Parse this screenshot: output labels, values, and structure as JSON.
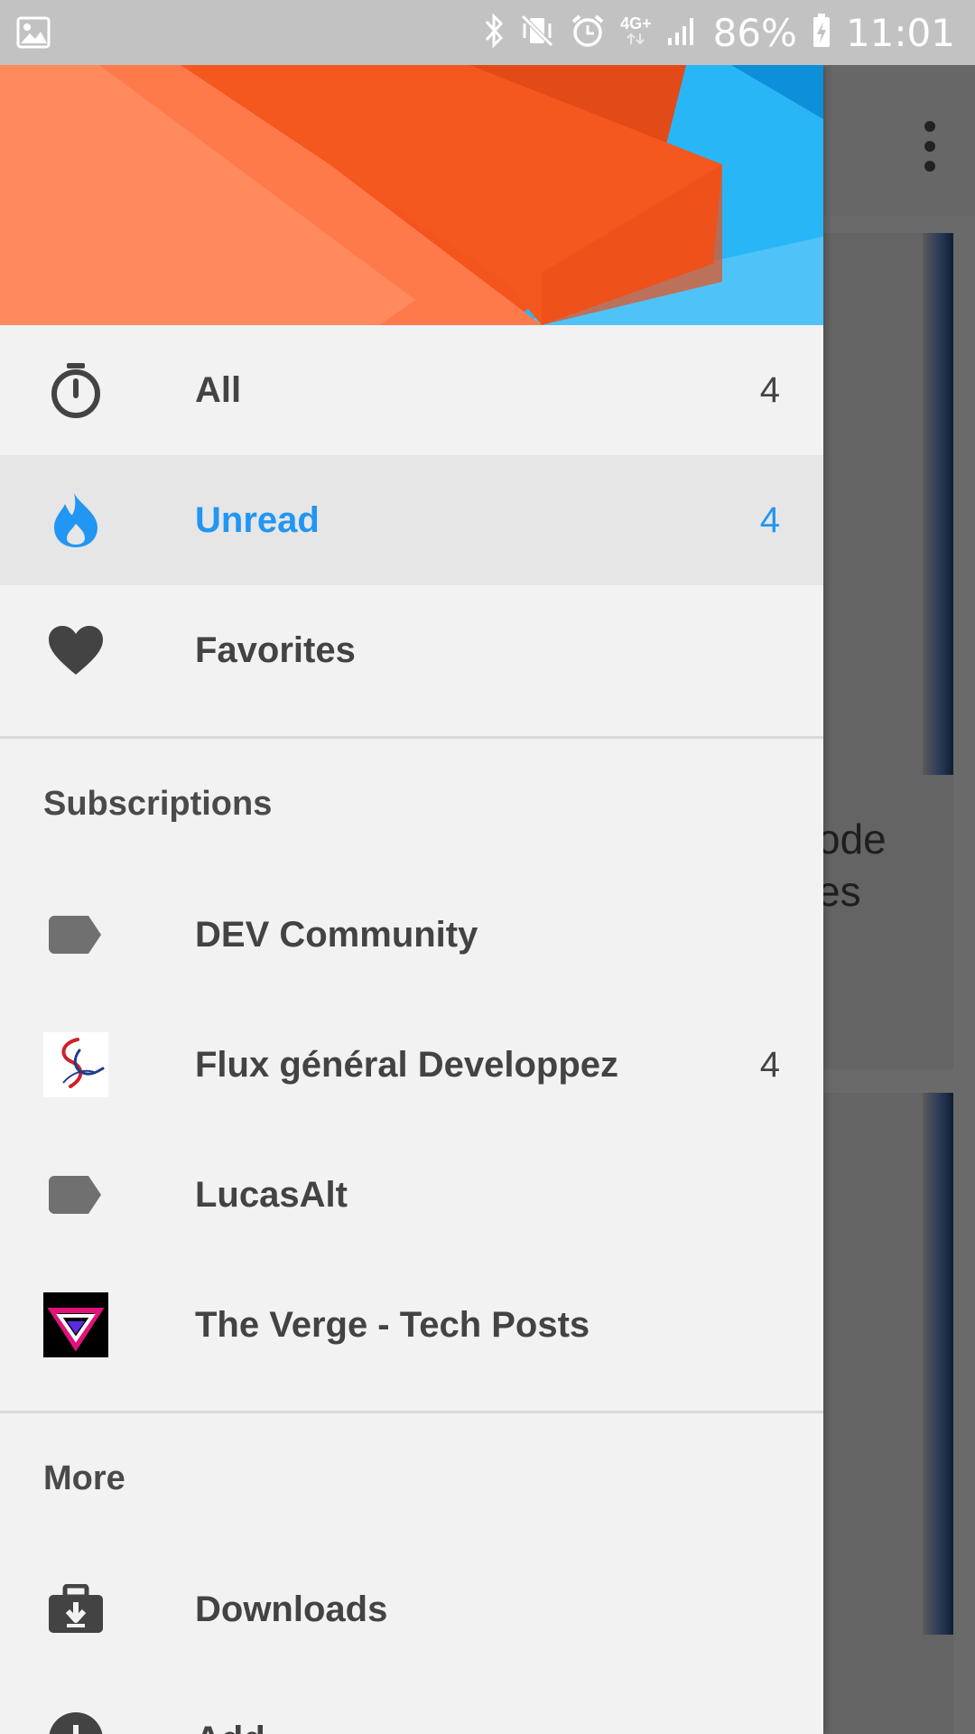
{
  "status_bar": {
    "network": "4G+",
    "battery": "86%",
    "time": "11:01"
  },
  "background_app": {
    "card_text_lines": [
      "ode",
      "es"
    ]
  },
  "drawer": {
    "nav": [
      {
        "label": "All",
        "count": "4",
        "icon": "stopwatch-icon"
      },
      {
        "label": "Unread",
        "count": "4",
        "icon": "flame-icon",
        "selected": true
      },
      {
        "label": "Favorites",
        "count": "",
        "icon": "heart-icon"
      }
    ],
    "subscriptions_header": "Subscriptions",
    "subscriptions": [
      {
        "label": "DEV Community",
        "count": "",
        "icon": "label-icon"
      },
      {
        "label": "Flux général Developpez",
        "count": "4",
        "icon": "developpez-favicon"
      },
      {
        "label": "LucasAlt",
        "count": "",
        "icon": "label-icon"
      },
      {
        "label": "The Verge - Tech Posts",
        "count": "",
        "icon": "verge-favicon"
      }
    ],
    "more_header": "More",
    "more": [
      {
        "label": "Downloads",
        "icon": "download-briefcase-icon"
      },
      {
        "label": "Add",
        "icon": "add-circle-icon"
      }
    ]
  },
  "colors": {
    "accent": "#2196f3",
    "status_bar": "#c2c2c2",
    "drawer_bg": "#f2f2f2",
    "selected_bg": "#e6e6e6"
  }
}
